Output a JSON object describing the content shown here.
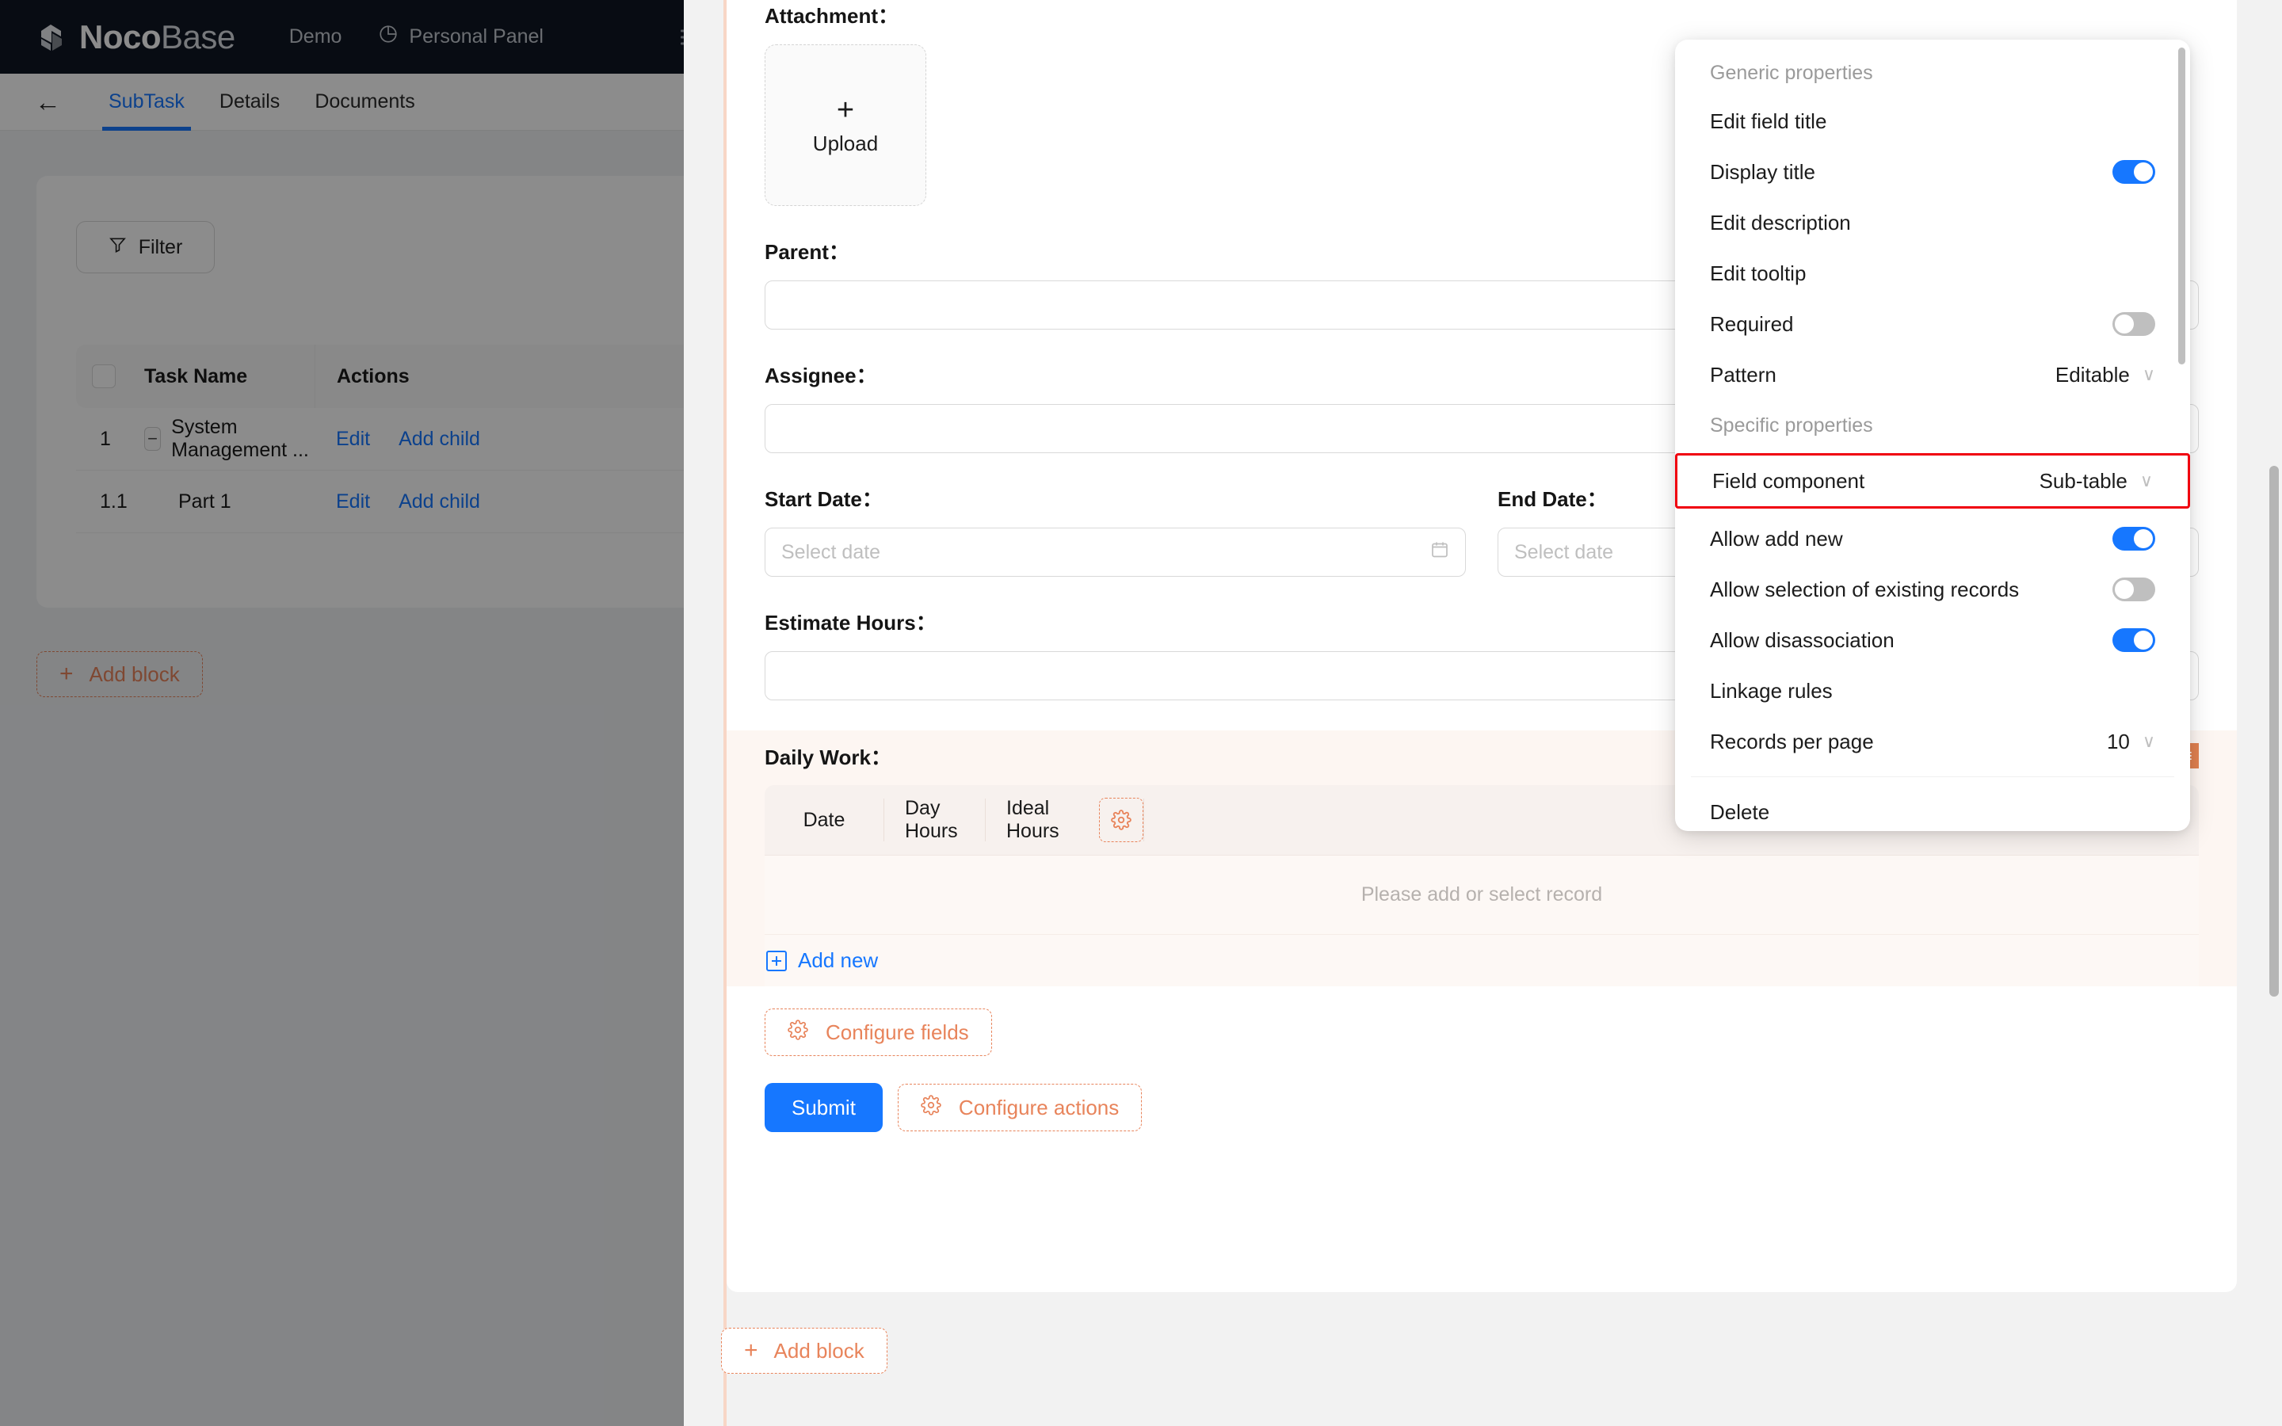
{
  "brand": {
    "name_bold": "Noco",
    "name_light": "Base",
    "logo_icon": "nocobase-cube-logo"
  },
  "topnav": {
    "items": [
      {
        "label": "Demo",
        "icon": null
      },
      {
        "label": "Personal Panel",
        "icon": "pie-chart-icon"
      }
    ]
  },
  "subnav": {
    "back_icon": "arrow-left-icon",
    "tabs": [
      {
        "label": "SubTask",
        "active": true
      },
      {
        "label": "Details",
        "active": false
      },
      {
        "label": "Documents",
        "active": false
      }
    ]
  },
  "list_block": {
    "filter_label": "Filter",
    "filter_icon": "funnel-icon",
    "columns": [
      "Task Name",
      "Actions"
    ],
    "rows": [
      {
        "index": "1",
        "name": "System Management ...",
        "expandable": true,
        "expander": "−",
        "actions": [
          "Edit",
          "Add child"
        ]
      },
      {
        "index": "1.1",
        "name": "Part 1",
        "expandable": false,
        "expander": "",
        "actions": [
          "Edit",
          "Add child"
        ]
      }
    ]
  },
  "add_block_background": {
    "label": "Add block",
    "icon": "plus-icon"
  },
  "add_block_foreground": {
    "label": "Add block",
    "icon": "plus-icon"
  },
  "form": {
    "attachment": {
      "label": "Attachment：",
      "upload_plus": "+",
      "upload_label": "Upload"
    },
    "parent": {
      "label": "Parent：",
      "value": ""
    },
    "assignee": {
      "label": "Assignee：",
      "value": ""
    },
    "start_date": {
      "label": "Start Date：",
      "placeholder": "Select date",
      "icon": "calendar-icon"
    },
    "end_date": {
      "label": "End Date：",
      "placeholder": "Select date",
      "icon": "calendar-icon"
    },
    "estimate_hours": {
      "label": "Estimate Hours：",
      "value": ""
    },
    "daily_work": {
      "label": "Daily Work：",
      "tools": [
        {
          "icon": "drag-move-icon"
        },
        {
          "icon": "plus-icon"
        },
        {
          "icon": "menu-icon"
        }
      ],
      "columns": [
        "Date",
        "Day Hours",
        "Ideal Hours"
      ],
      "header_gear_icon": "gear-icon",
      "empty_text": "Please add or select record",
      "add_new_label": "Add new",
      "add_new_icon": "plus-square-icon"
    },
    "configure_fields": {
      "label": "Configure fields",
      "icon": "gear-icon"
    },
    "submit": {
      "label": "Submit"
    },
    "configure_actions": {
      "label": "Configure actions",
      "icon": "gear-icon"
    }
  },
  "popover": {
    "groups": [
      {
        "title": "Generic properties",
        "items": [
          {
            "label": "Edit field title",
            "control": "none"
          },
          {
            "label": "Display title",
            "control": "switch",
            "state": "on"
          },
          {
            "label": "Edit description",
            "control": "none"
          },
          {
            "label": "Edit tooltip",
            "control": "none"
          },
          {
            "label": "Required",
            "control": "switch",
            "state": "off"
          },
          {
            "label": "Pattern",
            "control": "select",
            "value": "Editable",
            "chevron": "∨"
          }
        ]
      },
      {
        "title": "Specific properties",
        "items": [
          {
            "label": "Field component",
            "control": "select",
            "value": "Sub-table",
            "chevron": "∨",
            "highlighted": true
          },
          {
            "label": "Allow add new",
            "control": "switch",
            "state": "on"
          },
          {
            "label": "Allow selection of existing records",
            "control": "switch",
            "state": "off"
          },
          {
            "label": "Allow disassociation",
            "control": "switch",
            "state": "on"
          },
          {
            "label": "Linkage rules",
            "control": "none"
          },
          {
            "label": "Records per page",
            "control": "select",
            "value": "10",
            "chevron": "∨"
          }
        ]
      }
    ],
    "footer_item": {
      "label": "Delete"
    },
    "highlight_color": "#f0000f"
  },
  "colors": {
    "accent_blue": "#1677ff",
    "designer_orange": "#e8845b",
    "tool_orange": "#e08050",
    "header_dark": "#0f1623",
    "highlight_red": "#f0000f",
    "subtable_bg": "#fdf6f2"
  }
}
